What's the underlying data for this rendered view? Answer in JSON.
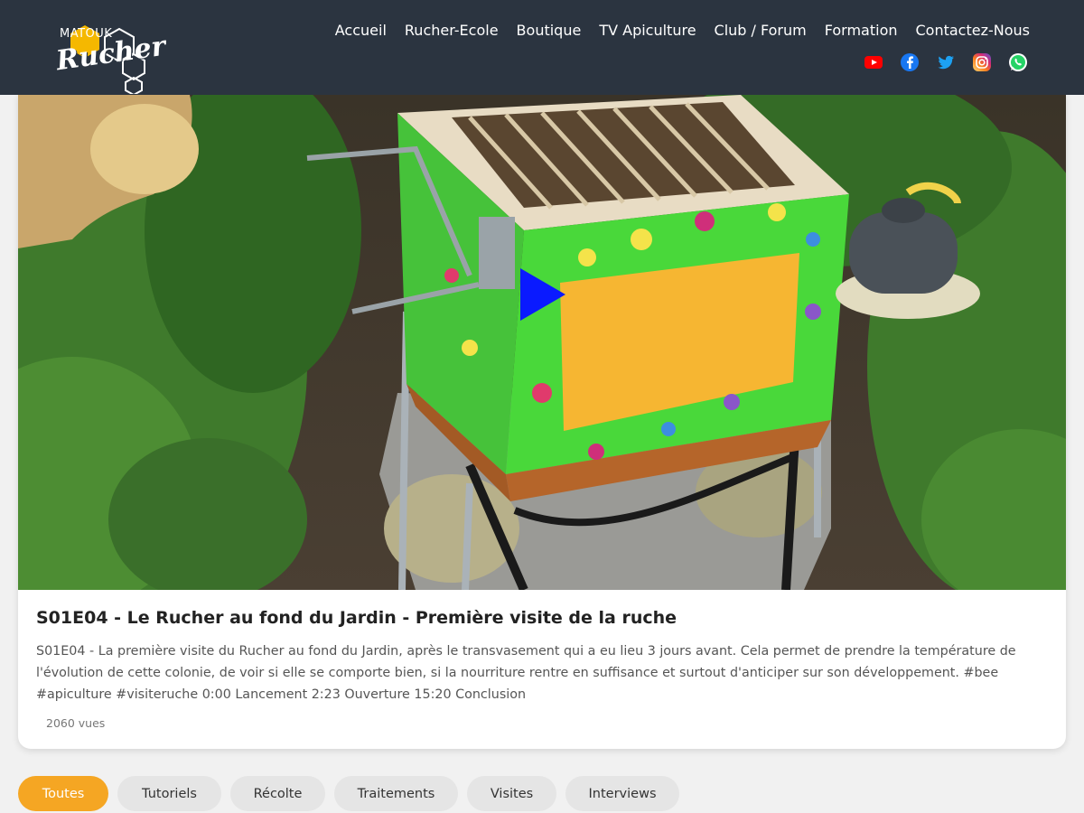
{
  "header": {
    "logo_top": "MATOUK",
    "logo_script": "Rucher",
    "nav": [
      "Accueil",
      "Rucher-Ecole",
      "Boutique",
      "TV Apiculture",
      "Club / Forum",
      "Formation",
      "Contactez-Nous"
    ],
    "social_icons": [
      "youtube-icon",
      "facebook-icon",
      "twitter-icon",
      "instagram-icon",
      "whatsapp-icon"
    ]
  },
  "video": {
    "title": "S01E04 - Le Rucher au fond du Jardin - Première visite de la ruche",
    "description": "S01E04 - La première visite du Rucher au fond du Jardin, après le transvasement qui a eu lieu 3 jours avant. Cela permet de prendre la température de l'évolution de cette colonie, de voir si elle se comporte bien, si la nourriture rentre en suffisance et surtout d'anticiper sur son développement. #bee #apiculture #visiteruche 0:00 Lancement 2:23 Ouverture 15:20 Conclusion",
    "views": "2060 vues"
  },
  "filters": {
    "items": [
      "Toutes",
      "Tutoriels",
      "Récolte",
      "Traitements",
      "Visites",
      "Interviews"
    ],
    "active": "Toutes"
  },
  "colors": {
    "header_bg": "#2b3440",
    "accent": "#f5a623",
    "chip_bg": "#e5e5e5",
    "play_icon": "#0a1aff"
  }
}
